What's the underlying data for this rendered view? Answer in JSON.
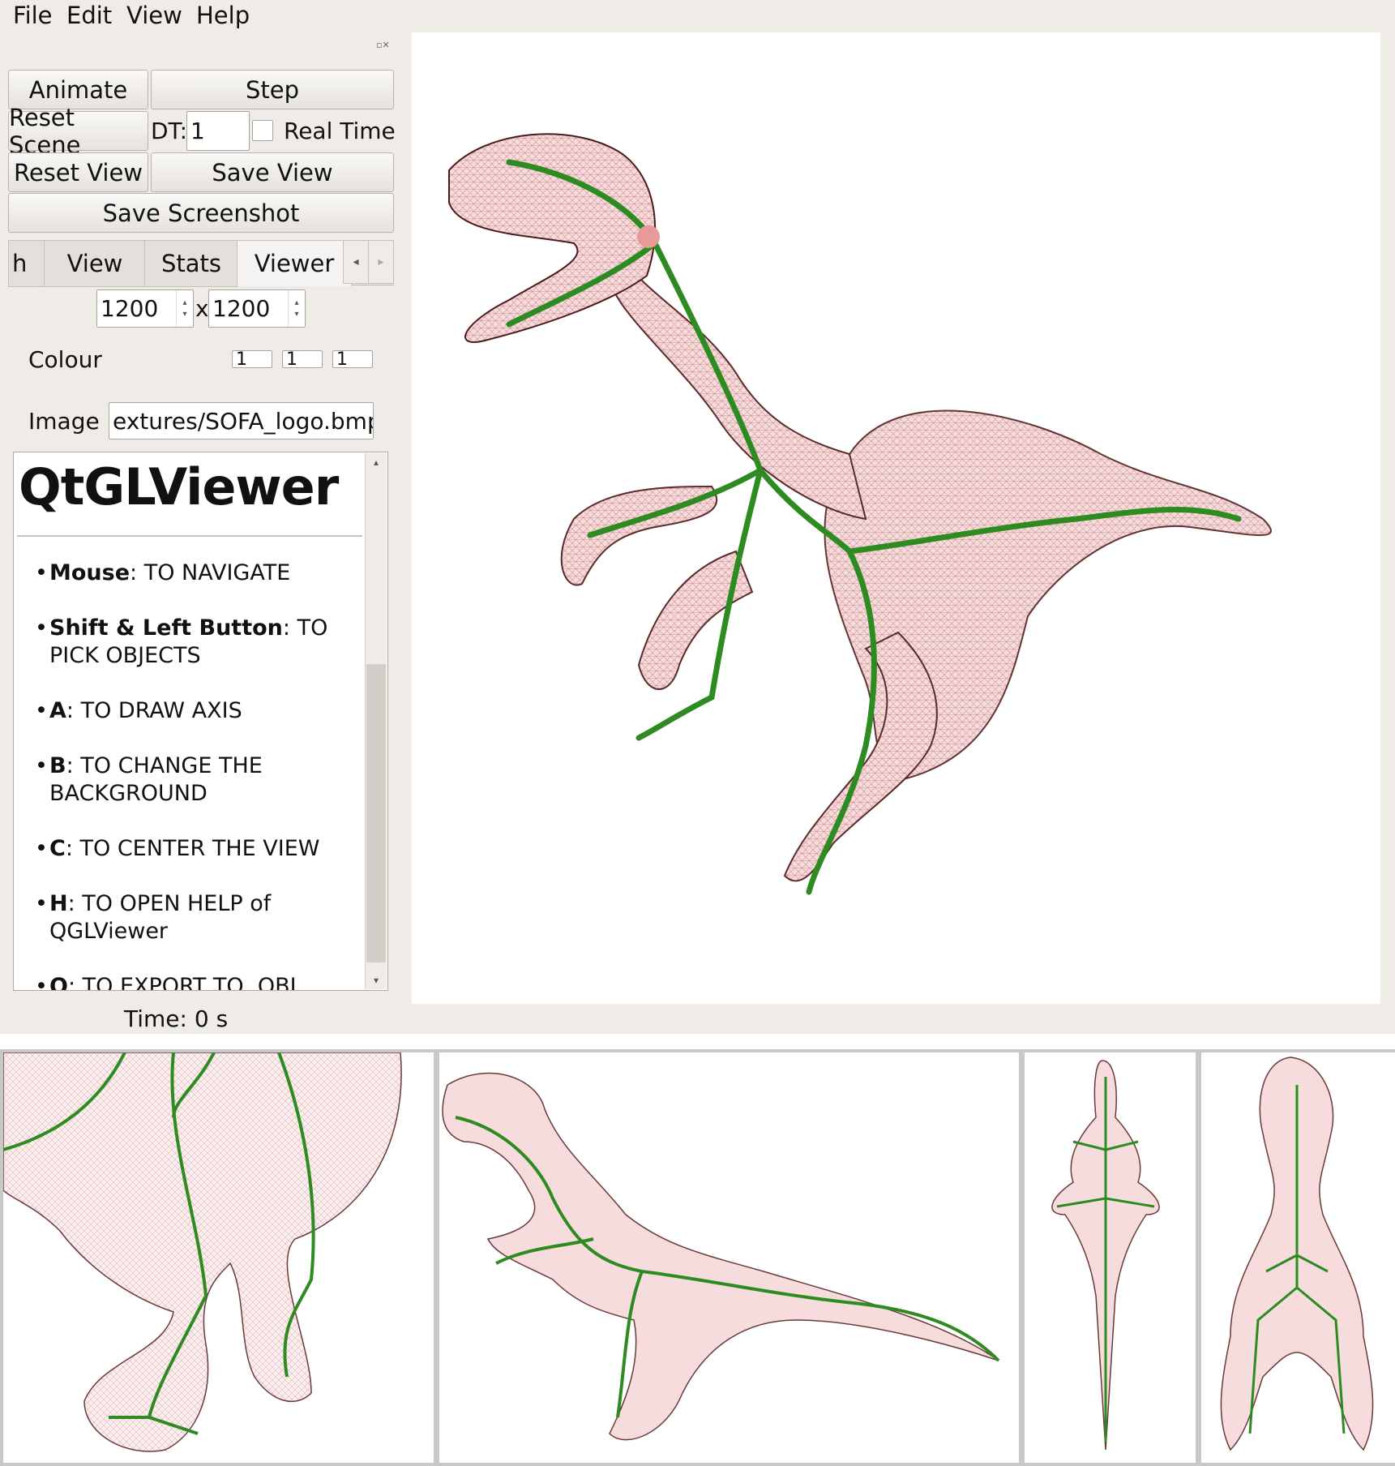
{
  "menu": {
    "items": [
      "File",
      "Edit",
      "View",
      "Help"
    ]
  },
  "controls": {
    "animate": "Animate",
    "step": "Step",
    "reset_scene": "Reset Scene",
    "dt_label": "DT:",
    "dt_value": "1",
    "real_time": "Real Time",
    "reset_view": "Reset View",
    "save_view": "Save View",
    "save_screenshot": "Save Screenshot"
  },
  "tabs": {
    "items": [
      "h",
      "View",
      "Stats",
      "Viewer"
    ],
    "active": "Viewer"
  },
  "viewer_tab": {
    "width": "1200",
    "height": "1200",
    "size_sep": "x",
    "colour_label": "Colour",
    "colour": [
      "1",
      "1",
      "1"
    ],
    "image_label": "Image",
    "image_path": "extures/SOFA_logo.bmp"
  },
  "help": {
    "title": "QtGLViewer",
    "items": [
      {
        "key": "Mouse",
        "line1": ": TO NAVIGATE",
        "line2": ""
      },
      {
        "key": "Shift & Left Button",
        "line1": ": TO",
        "line2": "PICK OBJECTS"
      },
      {
        "key": "A",
        "line1": ": TO DRAW AXIS",
        "line2": ""
      },
      {
        "key": "B",
        "line1": ": TO CHANGE THE",
        "line2": "BACKGROUND"
      },
      {
        "key": "C",
        "line1": ": TO CENTER THE VIEW",
        "line2": ""
      },
      {
        "key": "H",
        "line1": ": TO OPEN HELP of",
        "line2": "QGLViewer"
      },
      {
        "key": "O",
        "line1": ": TO EXPORT TO .OBJ",
        "line2": ""
      }
    ]
  },
  "status": {
    "time": "Time: 0 s"
  },
  "colors": {
    "mesh": "#b04a52",
    "skeleton": "#2e8b22",
    "window_bg": "#efebe7"
  }
}
